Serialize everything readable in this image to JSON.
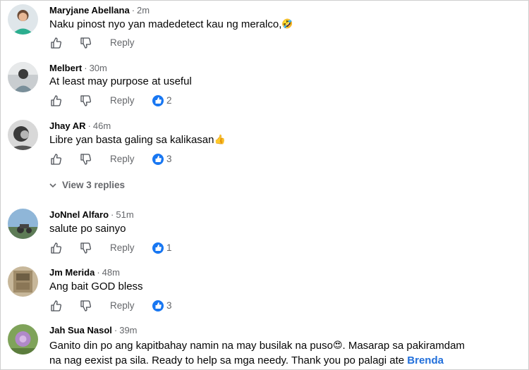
{
  "comments": [
    {
      "author": "Maryjane Abellana",
      "time": "2m",
      "text": "Naku pinost nyo yan madedetect kau ng meralco,",
      "emoji": "🤣",
      "reply_label": "Reply",
      "likes": "",
      "avatar": "avatar-1"
    },
    {
      "author": "Melbert",
      "time": "30m",
      "text": "At least may purpose at useful",
      "reply_label": "Reply",
      "likes": "2",
      "avatar": "avatar-2"
    },
    {
      "author": "Jhay AR",
      "time": "46m",
      "text": "Libre yan basta galing sa kalikasan",
      "emoji": "👍",
      "reply_label": "Reply",
      "likes": "3",
      "avatar": "avatar-3"
    },
    {
      "author": "JoNnel Alfaro",
      "time": "51m",
      "text": "salute po sainyo",
      "reply_label": "Reply",
      "likes": "1",
      "avatar": "avatar-4"
    },
    {
      "author": "Jm Merida",
      "time": "48m",
      "text": "Ang bait GOD bless",
      "reply_label": "Reply",
      "likes": "3",
      "avatar": "avatar-5"
    },
    {
      "author": "Jah Sua Nasol",
      "time": "39m",
      "text_line1": "Ganito din po ang kapitbahay namin na may busilak na puso",
      "emoji": "😍",
      "text_line1_cont": ". Masarap sa pakiramdam",
      "text_line2": "na nag eexist pa sila. Ready to help sa mga needy. Thank you po palagi ate ",
      "mention": "Brenda",
      "avatar": "avatar-6"
    }
  ],
  "view_replies_label": "View 3 replies",
  "separator": "·",
  "icons": {
    "like": "thumbs-up-icon",
    "dislike": "thumbs-down-icon",
    "chevron": "chevron-down-icon",
    "like_badge": "like-reaction-icon"
  },
  "colors": {
    "like_blue": "#1877f2",
    "meta_gray": "#65676b",
    "mention": "#216fdb"
  }
}
